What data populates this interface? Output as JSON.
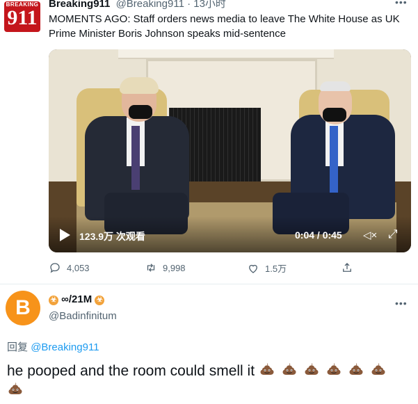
{
  "tweet": {
    "avatar_top_text": "BREAKING",
    "avatar_number": "911",
    "display_name": "Breaking911",
    "handle_time": "@Breaking911 · 13小时",
    "text": "MOMENTS AGO: Staff orders news media to leave The White House as UK Prime Minister Boris Johnson speaks mid-sentence",
    "video": {
      "views": "123.9万 次观看",
      "time": "0:04 / 0:45"
    },
    "actions": {
      "replies": "4,053",
      "retweets": "9,998",
      "likes": "1.5万"
    }
  },
  "reply": {
    "avatar_symbol": "B",
    "display_name": "∞/21M",
    "biohazard_symbol": "☣",
    "handle": "@Badinfinitum",
    "replying_prefix": "回复",
    "replying_to": "@Breaking911",
    "text": "he pooped and the room could smell it",
    "emoji_count": 7,
    "emoji_name": "pile-of-poo-icon"
  },
  "colors": {
    "link": "#1d9bf0",
    "secondary_text": "#536471",
    "bitcoin_orange": "#f7931a",
    "breaking_red": "#c4161c"
  }
}
